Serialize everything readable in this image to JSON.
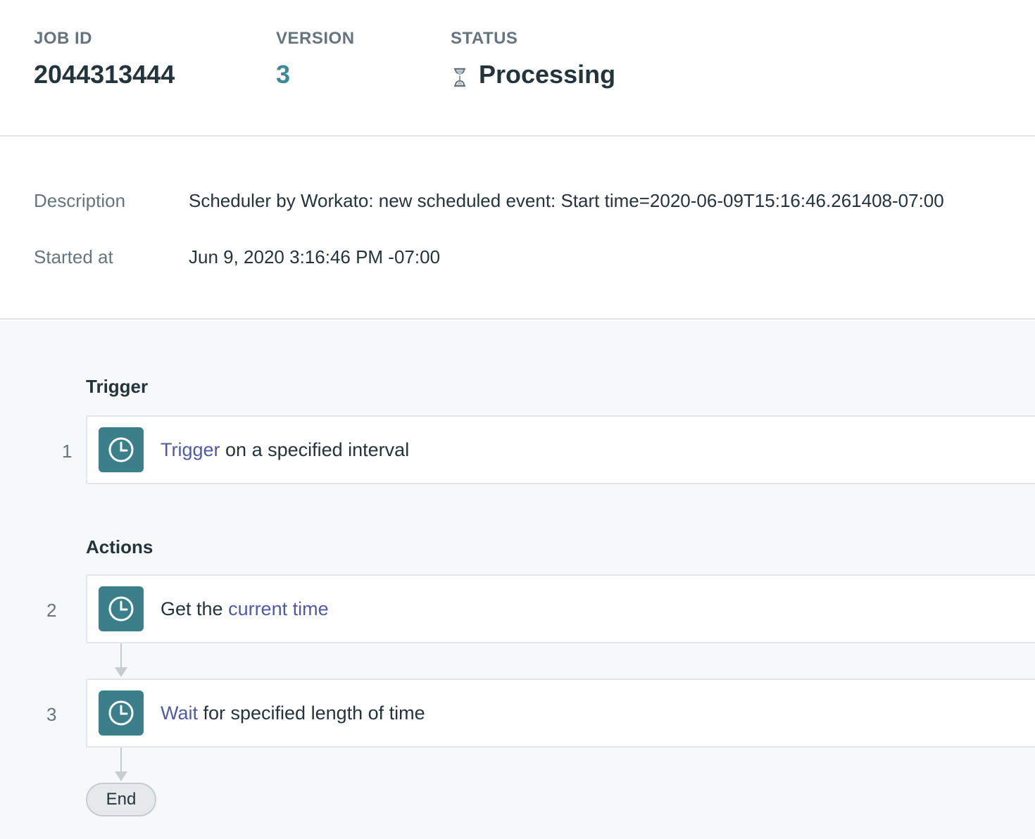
{
  "header": {
    "job_id_label": "JOB ID",
    "job_id_value": "2044313444",
    "version_label": "VERSION",
    "version_value": "3",
    "status_label": "STATUS",
    "status_value": "Processing",
    "status_icon": "hourglass-icon"
  },
  "details": {
    "description_label": "Description",
    "description_value": "Scheduler by Workato: new scheduled event: Start time=2020-06-09T15:16:46.261408-07:00",
    "started_label": "Started at",
    "started_value": "Jun 9, 2020 3:16:46 PM -07:00"
  },
  "flow": {
    "trigger_title": "Trigger",
    "actions_title": "Actions",
    "steps": [
      {
        "number": "1",
        "link": "Trigger",
        "before": "",
        "after": " on a specified interval",
        "icon": "clock-icon"
      },
      {
        "number": "2",
        "before": "Get the ",
        "link": "current time",
        "after": "",
        "icon": "clock-icon"
      },
      {
        "number": "3",
        "link": "Wait",
        "before": "",
        "after": " for specified length of time",
        "icon": "clock-icon"
      }
    ],
    "end_label": "End"
  },
  "colors": {
    "accent": "#3a8a99",
    "icon_bg": "#3a7f8a",
    "link": "#4f5aa8"
  }
}
